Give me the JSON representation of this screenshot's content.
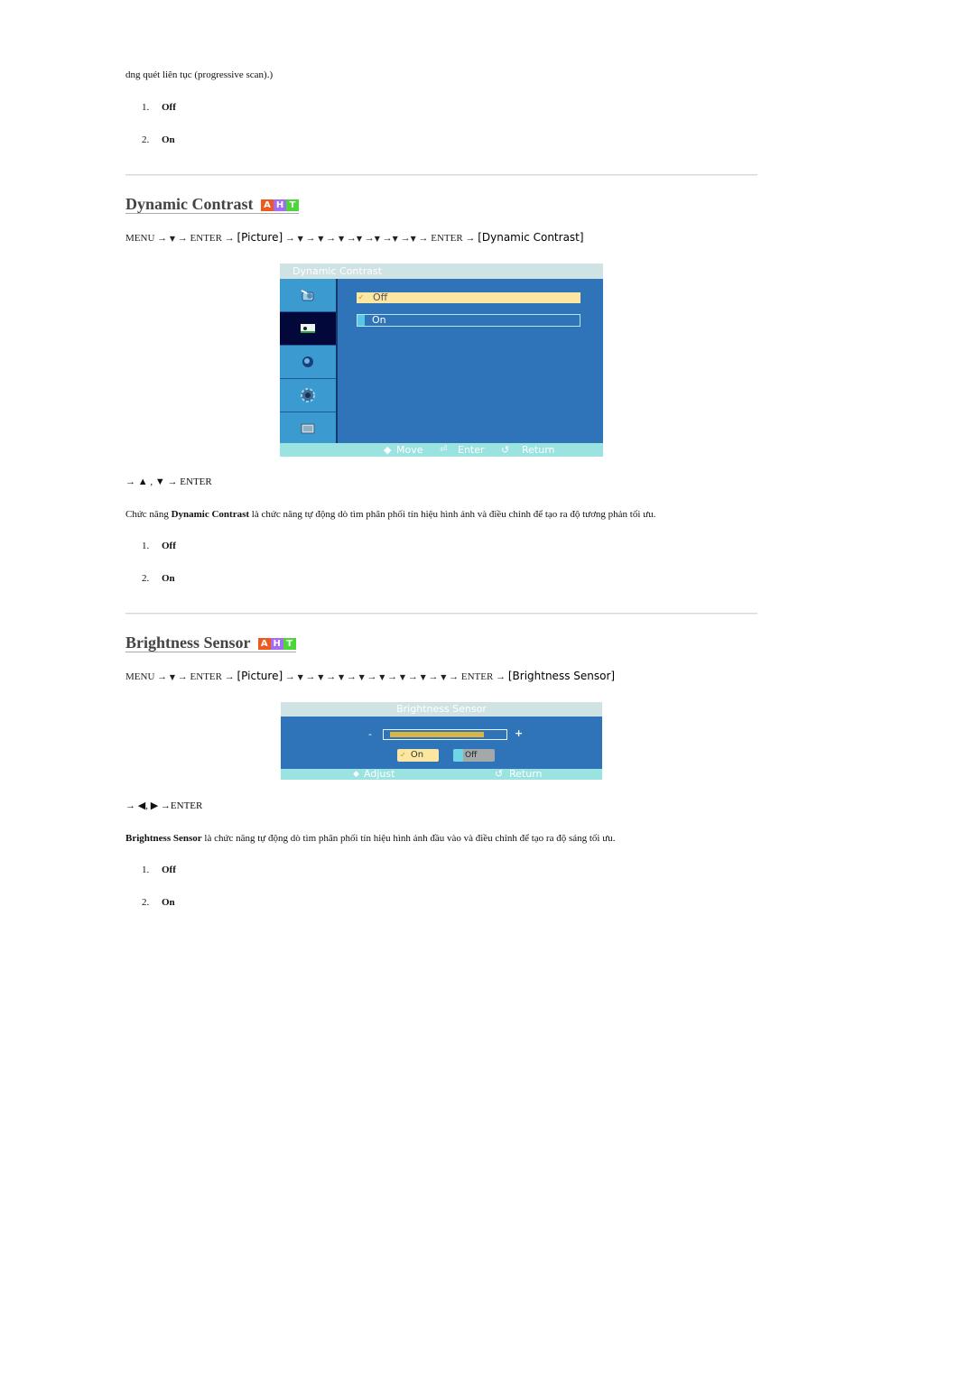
{
  "intro": {
    "text": "dng quét liên tục (progressive scan).)",
    "options": [
      {
        "num": "1.",
        "label": "Off"
      },
      {
        "num": "2.",
        "label": "On"
      }
    ]
  },
  "dynamic_contrast": {
    "heading": "Dynamic Contrast",
    "badge": {
      "a": "A",
      "h": "H",
      "t": "T"
    },
    "path": {
      "menu": "MENU",
      "arrow": "→",
      "down": "▼",
      "enter": "ENTER",
      "picture": "[Picture]",
      "target": "[Dynamic Contrast]"
    },
    "osd": {
      "title": "Dynamic Contrast",
      "options": [
        {
          "label": "Off",
          "selected": true,
          "mark": "✓"
        },
        {
          "label": "On",
          "selected": false
        }
      ],
      "sidebar_icons": [
        "input-icon",
        "picture-icon",
        "sound-icon",
        "setup-icon",
        "multi-control-icon"
      ],
      "footer": {
        "move": "Move",
        "enter": "Enter",
        "return": "Return"
      }
    },
    "nav_hint": "→ ▲ , ▼ → ENTER",
    "description_prefix": "Chức năng ",
    "description_bold": "Dynamic Contrast",
    "description_suffix": " là chức năng tự động dò tìm phân phối tín hiệu hình ảnh và điều chỉnh để tạo ra độ tương phản tối ưu.",
    "options": [
      {
        "num": "1.",
        "label": "Off"
      },
      {
        "num": "2.",
        "label": "On"
      }
    ]
  },
  "brightness_sensor": {
    "heading": "Brightness Sensor",
    "badge": {
      "a": "A",
      "h": "H",
      "t": "T"
    },
    "path": {
      "menu": "MENU",
      "arrow": "→",
      "down": "▼",
      "enter": "ENTER",
      "picture": "[Picture]",
      "target": "[Brightness Sensor]"
    },
    "osd": {
      "title": "Brightness Sensor",
      "minus": "-",
      "plus": "+",
      "slider_level_percent": 85,
      "buttons": [
        {
          "label": "On",
          "selected": true,
          "mark": "✓"
        },
        {
          "label": "Off",
          "selected": false
        }
      ],
      "footer": {
        "adjust": "Adjust",
        "return": "Return"
      }
    },
    "nav_hint": "→ ◀, ▶ →ENTER",
    "description_bold": "Brightness Sensor",
    "description_suffix": " là chức năng tự động dò tìm phân phối tín hiệu hình ảnh đầu vào và điều chỉnh để tạo ra độ sáng tối ưu.",
    "options": [
      {
        "num": "1.",
        "label": "Off"
      },
      {
        "num": "2.",
        "label": "On"
      }
    ]
  }
}
